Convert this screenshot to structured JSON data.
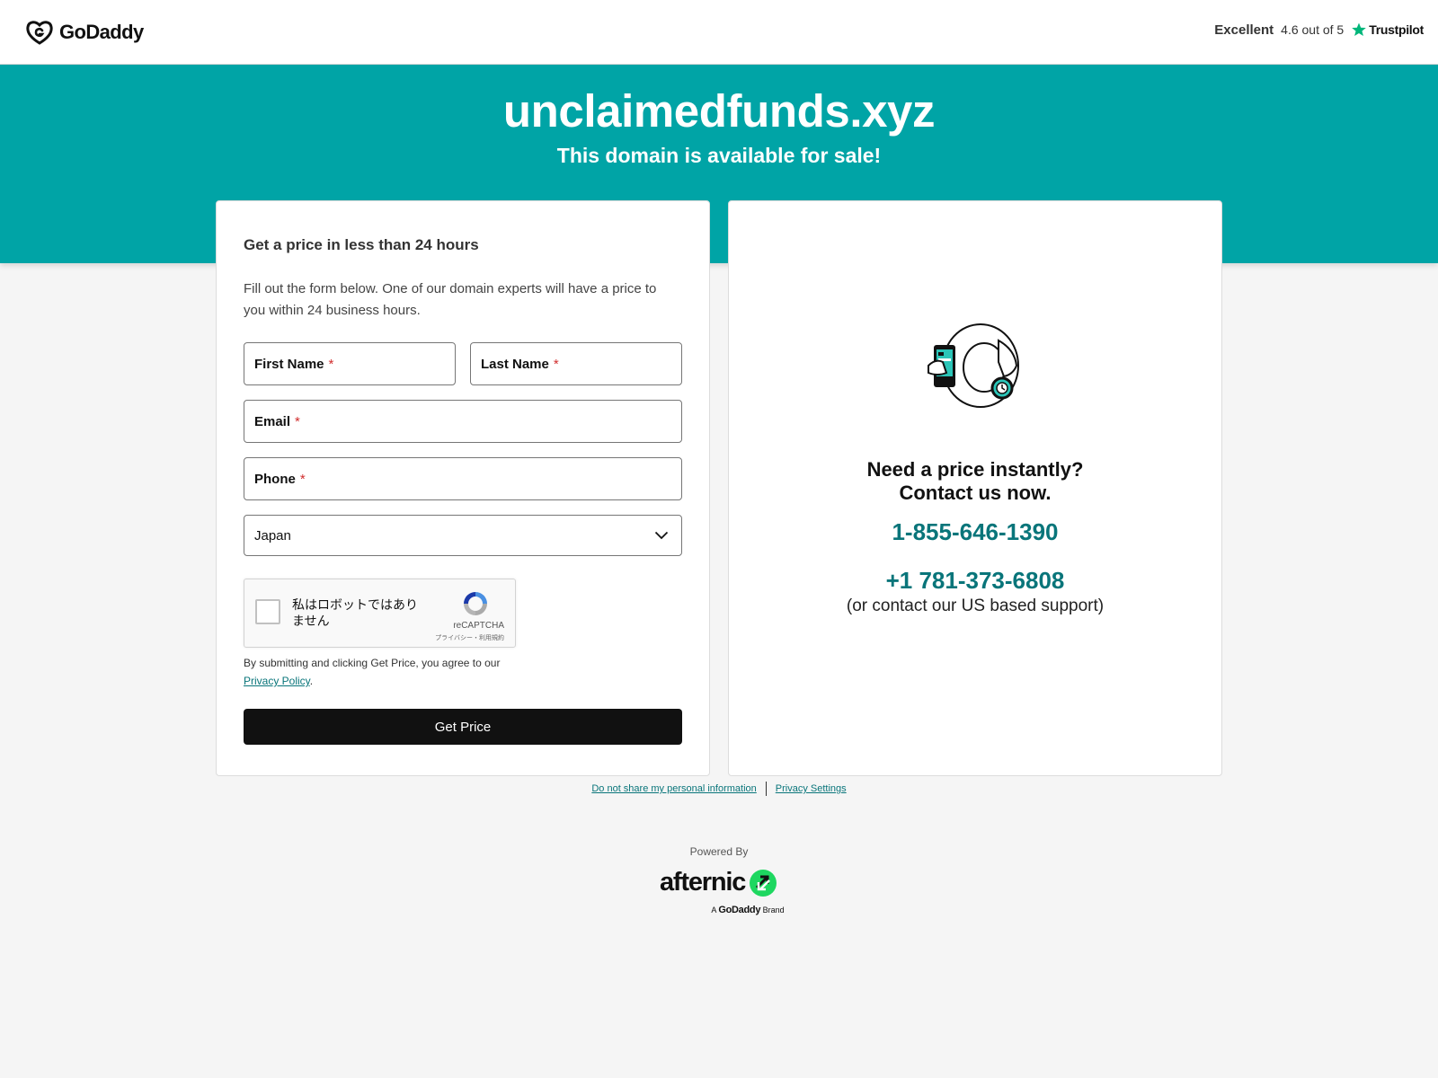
{
  "header": {
    "logo_text": "GoDaddy",
    "rating_label": "Excellent",
    "rating_value": "4.6 out of 5",
    "trustpilot": "Trustpilot"
  },
  "hero": {
    "domain": "unclaimedfunds.xyz",
    "subtitle": "This domain is available for sale!"
  },
  "form": {
    "title": "Get a price in less than 24 hours",
    "description": "Fill out the form below. One of our domain experts will have a price to you within 24 business hours.",
    "first_name_label": "First Name",
    "last_name_label": "Last Name",
    "email_label": "Email",
    "phone_label": "Phone",
    "required_mark": "*",
    "country_value": "Japan",
    "captcha_text": "私はロボットではありません",
    "captcha_brand": "reCAPTCHA",
    "captcha_terms": "プライバシー・利用規約",
    "agree_text": "By submitting and clicking Get Price, you agree to our",
    "privacy_link": "Privacy Policy",
    "agree_end": ".",
    "submit_label": "Get Price"
  },
  "contact": {
    "heading_line1": "Need a price instantly?",
    "heading_line2": "Contact us now.",
    "phone_primary": "1-855-646-1390",
    "phone_secondary": "+1 781-373-6808",
    "support_note": "(or contact our US based support)"
  },
  "footer": {
    "do_not_share": "Do not share my personal information",
    "privacy_settings": "Privacy Settings",
    "powered_by": "Powered By",
    "afternic": "afternic",
    "brand_prefix": "A",
    "brand_name": "GoDaddy",
    "brand_suffix": "Brand"
  },
  "colors": {
    "teal": "#00a4a6",
    "link_teal": "#09757a",
    "button_black": "#111111",
    "required_red": "#d12e2e"
  }
}
